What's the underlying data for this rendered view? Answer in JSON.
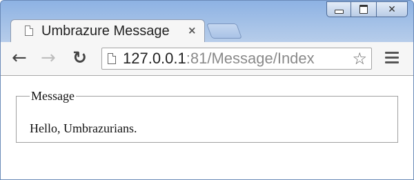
{
  "window": {
    "controls": {
      "minimize_icon": "minimize-icon",
      "maximize_icon": "maximize-icon",
      "close_glyph": "✕"
    }
  },
  "tab": {
    "title": "Umbrazure Message",
    "close_glyph": "×",
    "icon": "page-icon"
  },
  "toolbar": {
    "back_glyph": "←",
    "forward_glyph": "→",
    "reload_glyph": "↻",
    "url_host": "127.0.0.1",
    "url_rest": ":81/Message/Index",
    "star_glyph": "☆"
  },
  "content": {
    "legend": "Message",
    "message": "Hello, Umbrazurians."
  },
  "colors": {
    "frame": "#8db2e3",
    "toolbar": "#f6f6f6",
    "url_muted": "#8a8a8a"
  }
}
